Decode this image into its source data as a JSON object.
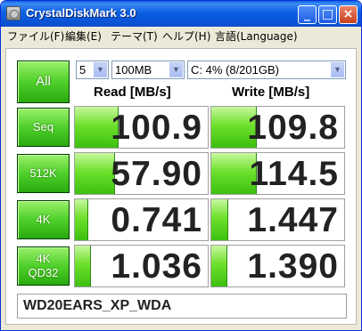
{
  "window": {
    "title": "CrystalDiskMark 3.0",
    "controls": {
      "minimize": "_",
      "maximize": "□",
      "close": "×"
    }
  },
  "menu": [
    "ファイル(F)",
    "編集(E)",
    "テーマ(T)",
    "ヘルプ(H)",
    "言語(Language)"
  ],
  "run_all_label": "All",
  "selects": {
    "count": "5",
    "size": "100MB",
    "drive": "C: 4% (8/201GB)"
  },
  "headers": {
    "read": "Read [MB/s]",
    "write": "Write [MB/s]"
  },
  "tests": [
    {
      "label": [
        "Seq"
      ],
      "read": "100.9",
      "write": "109.8",
      "read_level": 0.32,
      "write_level": 0.33
    },
    {
      "label": [
        "512K"
      ],
      "read": "57.90",
      "write": "114.5",
      "read_level": 0.29,
      "write_level": 0.33
    },
    {
      "label": [
        "4K"
      ],
      "read": "0.741",
      "write": "1.447",
      "read_level": 0.09,
      "write_level": 0.12
    },
    {
      "label": [
        "4K",
        "QD32"
      ],
      "read": "1.036",
      "write": "1.390",
      "read_level": 0.11,
      "write_level": 0.11
    }
  ],
  "comment": "WD20EARS_XP_WDA",
  "colors": {
    "titlebar": "#0a55d8",
    "button_green": "#4fd02a",
    "bar_green": "#6ee02c"
  }
}
